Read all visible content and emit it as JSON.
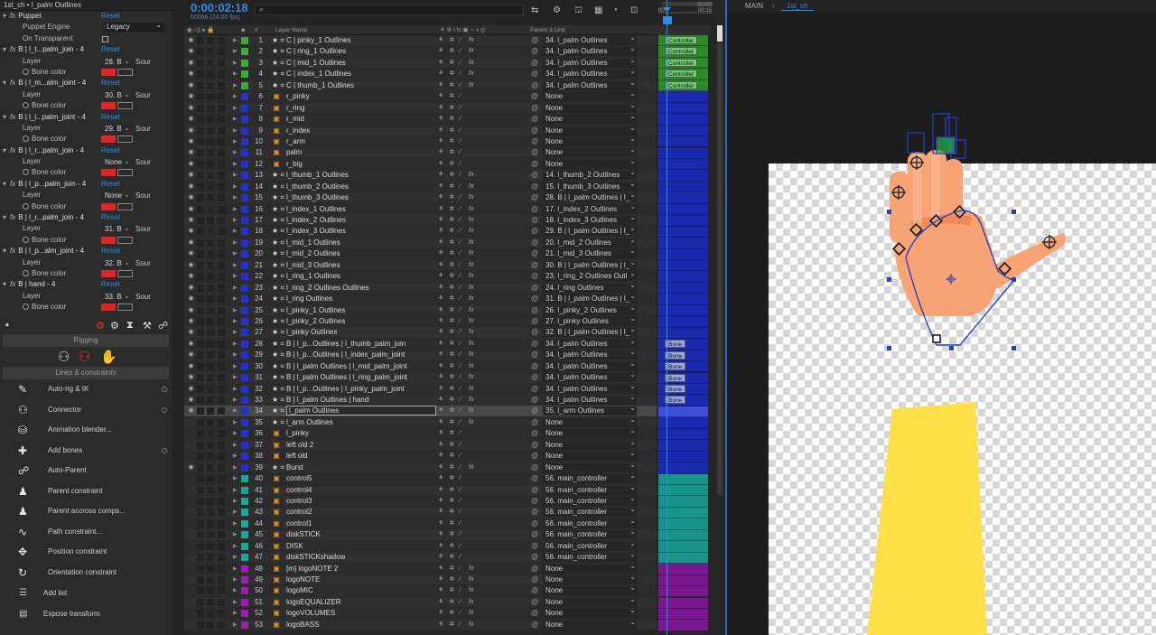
{
  "left": {
    "title": "1st_ch • l_palm Outlines",
    "effects": [
      {
        "kind": "head",
        "label": "Puppet",
        "reset": "Reset"
      },
      {
        "kind": "select",
        "label": "Puppet Engine",
        "value": "Legacy"
      },
      {
        "kind": "check",
        "label": "On Transparent"
      },
      {
        "kind": "head",
        "label": "B | l_t...palm_join - 4",
        "reset": "Reset"
      },
      {
        "kind": "layer",
        "label": "Layer",
        "value": "28. B",
        "dd": "Sour"
      },
      {
        "kind": "color",
        "label": "Bone color"
      },
      {
        "kind": "head",
        "label": "B | l_m...alm_joint - 4",
        "reset": "Reset"
      },
      {
        "kind": "layer",
        "label": "Layer",
        "value": "30. B",
        "dd": "Sour"
      },
      {
        "kind": "color",
        "label": "Bone color"
      },
      {
        "kind": "head",
        "label": "B | l_i...palm_joint - 4",
        "reset": "Reset"
      },
      {
        "kind": "layer",
        "label": "Layer",
        "value": "29. B",
        "dd": "Sour"
      },
      {
        "kind": "color",
        "label": "Bone color"
      },
      {
        "kind": "head",
        "label": "B | l_r...palm_join - 4",
        "reset": "Reset"
      },
      {
        "kind": "layer",
        "label": "Layer",
        "value": "None",
        "dd": "Sour"
      },
      {
        "kind": "color",
        "label": "Bone color"
      },
      {
        "kind": "head",
        "label": "B | l_p...palm_join - 4",
        "reset": "Reset"
      },
      {
        "kind": "layer",
        "label": "Layer",
        "value": "None",
        "dd": "Sour"
      },
      {
        "kind": "color",
        "label": "Bone color"
      },
      {
        "kind": "head",
        "label": "B | l_r...palm_join - 4",
        "reset": "Reset"
      },
      {
        "kind": "layer",
        "label": "Layer",
        "value": "31. B",
        "dd": "Sour"
      },
      {
        "kind": "color",
        "label": "Bone color"
      },
      {
        "kind": "head",
        "label": "B | l_p...alm_joint - 4",
        "reset": "Reset"
      },
      {
        "kind": "layer",
        "label": "Layer",
        "value": "32. B",
        "dd": "Sour"
      },
      {
        "kind": "color",
        "label": "Bone color"
      },
      {
        "kind": "head",
        "label": "B | hand - 4",
        "reset": "Reset"
      },
      {
        "kind": "layer",
        "label": "Layer",
        "value": "33. B",
        "dd": "Sour"
      },
      {
        "kind": "color",
        "label": "Bone color"
      }
    ],
    "bone_color": "#e32424"
  },
  "duik": {
    "rigging_label": "Rigging",
    "links_label": "Links & constraints",
    "items": [
      {
        "label": "Auto-rig & IK",
        "icon": "auto-rig-icon",
        "glyph": "✎",
        "dot": true
      },
      {
        "label": "Connector",
        "icon": "connector-icon",
        "glyph": "⚇",
        "dot": true
      },
      {
        "label": "Animation blender...",
        "icon": "animation-blender-icon",
        "glyph": "⛁",
        "dot": false
      },
      {
        "label": "Add bones",
        "icon": "add-bones-icon",
        "glyph": "✚",
        "dot": true
      },
      {
        "label": "Auto-Parent",
        "icon": "auto-parent-icon",
        "glyph": "☍",
        "dot": false
      },
      {
        "label": "Parent constraint",
        "icon": "parent-constraint-icon",
        "glyph": "♟",
        "dot": false
      },
      {
        "label": "Parent accross comps...",
        "icon": "parent-across-comps-icon",
        "glyph": "♟",
        "dot": false
      },
      {
        "label": "Path constraint...",
        "icon": "path-constraint-icon",
        "glyph": "∿",
        "dot": false
      },
      {
        "label": "Position constraint",
        "icon": "position-constraint-icon",
        "glyph": "✥",
        "dot": false
      },
      {
        "label": "Orientation constraint",
        "icon": "orientation-constraint-icon",
        "glyph": "↻",
        "dot": false
      }
    ],
    "add_list": "Add list",
    "expose_transform": "Expose transform"
  },
  "timeline": {
    "timecode": "0:00:02:18",
    "timecode_sub": "00066 (24.00 fps)",
    "search_placeholder": "⌕",
    "col_layer_name": "Layer Name",
    "col_number": "#",
    "col_parent": "Parent & Link",
    "fx_label": "fx",
    "layers": [
      {
        "n": "1",
        "name": "C | pinky_1 Outlines",
        "type": "shape",
        "color": "#3daa3d",
        "parent": "34. l_palm Outlines",
        "fx": true,
        "eye": true,
        "track": "#2a8a2a",
        "tag": "Controller"
      },
      {
        "n": "2",
        "name": "C | ring_1 Outlines",
        "type": "shape",
        "color": "#3daa3d",
        "parent": "34. l_palm Outlines",
        "fx": true,
        "eye": true,
        "track": "#2a8a2a",
        "tag": "Controller"
      },
      {
        "n": "3",
        "name": "C | mid_1 Outlines",
        "type": "shape",
        "color": "#3daa3d",
        "parent": "34. l_palm Outlines",
        "fx": true,
        "eye": true,
        "track": "#2a8a2a",
        "tag": "Controller"
      },
      {
        "n": "4",
        "name": "C | index_1 Outlines",
        "type": "shape",
        "color": "#3daa3d",
        "parent": "34. l_palm Outlines",
        "fx": true,
        "eye": true,
        "track": "#2a8a2a",
        "tag": "Controller"
      },
      {
        "n": "5",
        "name": "C | thumb_1 Outlines",
        "type": "shape",
        "color": "#3daa3d",
        "parent": "34. l_palm Outlines",
        "fx": true,
        "eye": true,
        "track": "#2a8a2a",
        "tag": "Controller"
      },
      {
        "n": "6",
        "name": "r_pinky",
        "type": "comp",
        "color": "#2233cc",
        "parent": "None",
        "fx": false,
        "eye": true,
        "track": "#1b2bb0",
        "tag": ""
      },
      {
        "n": "7",
        "name": "r_ring",
        "type": "comp",
        "color": "#2233cc",
        "parent": "None",
        "fx": false,
        "eye": true,
        "track": "#1b2bb0",
        "tag": ""
      },
      {
        "n": "8",
        "name": "r_mid",
        "type": "comp",
        "color": "#2233cc",
        "parent": "None",
        "fx": false,
        "eye": true,
        "track": "#1b2bb0",
        "tag": ""
      },
      {
        "n": "9",
        "name": "r_index",
        "type": "comp",
        "color": "#2233cc",
        "parent": "None",
        "fx": false,
        "eye": true,
        "track": "#1b2bb0",
        "tag": ""
      },
      {
        "n": "10",
        "name": "r_arm",
        "type": "comp",
        "color": "#2233cc",
        "parent": "None",
        "fx": false,
        "eye": true,
        "track": "#1b2bb0",
        "tag": ""
      },
      {
        "n": "11",
        "name": "palm",
        "type": "comp",
        "color": "#2233cc",
        "parent": "None",
        "fx": false,
        "eye": true,
        "track": "#1b2bb0",
        "tag": ""
      },
      {
        "n": "12",
        "name": "r_big",
        "type": "comp",
        "color": "#2233cc",
        "parent": "None",
        "fx": false,
        "eye": true,
        "track": "#1b2bb0",
        "tag": ""
      },
      {
        "n": "13",
        "name": "l_thumb_1 Outlines",
        "type": "shape",
        "color": "#2233cc",
        "parent": "14. l_thumb_2 Outlines",
        "fx": true,
        "eye": true,
        "track": "#1b2bb0",
        "tag": ""
      },
      {
        "n": "14",
        "name": "l_thumb_2 Outlines",
        "type": "shape",
        "color": "#2233cc",
        "parent": "15. l_thumb_3 Outlines",
        "fx": true,
        "eye": true,
        "track": "#1b2bb0",
        "tag": ""
      },
      {
        "n": "15",
        "name": "l_thumb_3 Outlines",
        "type": "shape",
        "color": "#2233cc",
        "parent": "28. B | l_palm Outlines | l_",
        "fx": true,
        "eye": true,
        "track": "#1b2bb0",
        "tag": ""
      },
      {
        "n": "16",
        "name": "l_index_1 Outlines",
        "type": "shape",
        "color": "#2233cc",
        "parent": "17. l_index_2 Outlines",
        "fx": true,
        "eye": true,
        "track": "#1b2bb0",
        "tag": ""
      },
      {
        "n": "17",
        "name": "l_index_2 Outlines",
        "type": "shape",
        "color": "#2233cc",
        "parent": "18. l_index_3 Outlines",
        "fx": true,
        "eye": true,
        "track": "#1b2bb0",
        "tag": ""
      },
      {
        "n": "18",
        "name": "l_index_3 Outlines",
        "type": "shape",
        "color": "#2233cc",
        "parent": "29. B | l_palm Outlines | l_",
        "fx": true,
        "eye": true,
        "track": "#1b2bb0",
        "tag": ""
      },
      {
        "n": "19",
        "name": "l_mid_1 Outlines",
        "type": "shape",
        "color": "#2233cc",
        "parent": "20. l_mid_2 Outlines",
        "fx": true,
        "eye": true,
        "track": "#1b2bb0",
        "tag": ""
      },
      {
        "n": "20",
        "name": "l_mid_2 Outlines",
        "type": "shape",
        "color": "#2233cc",
        "parent": "21. l_mid_3 Outlines",
        "fx": true,
        "eye": true,
        "track": "#1b2bb0",
        "tag": ""
      },
      {
        "n": "21",
        "name": "l_mid_3 Outlines",
        "type": "shape",
        "color": "#2233cc",
        "parent": "30. B | l_palm Outlines | l_",
        "fx": true,
        "eye": true,
        "track": "#1b2bb0",
        "tag": ""
      },
      {
        "n": "22",
        "name": "l_ring_1 Outlines",
        "type": "shape",
        "color": "#2233cc",
        "parent": "23. l_ring_2 Outlines Outl",
        "fx": true,
        "eye": true,
        "track": "#1b2bb0",
        "tag": ""
      },
      {
        "n": "23",
        "name": "l_ring_2 Outlines Outlines",
        "type": "shape",
        "color": "#2233cc",
        "parent": "24. l_ring Outlines",
        "fx": true,
        "eye": true,
        "track": "#1b2bb0",
        "tag": ""
      },
      {
        "n": "24",
        "name": "l_ring Outlines",
        "type": "shape",
        "color": "#2233cc",
        "parent": "31. B | l_palm Outlines | l_",
        "fx": true,
        "eye": true,
        "track": "#1b2bb0",
        "tag": ""
      },
      {
        "n": "25",
        "name": "l_pinky_1 Outlines",
        "type": "shape",
        "color": "#2233cc",
        "parent": "26. l_pinky_2 Outlines",
        "fx": true,
        "eye": true,
        "track": "#1b2bb0",
        "tag": ""
      },
      {
        "n": "26",
        "name": "l_pinky_2 Outlines",
        "type": "shape",
        "color": "#2233cc",
        "parent": "27. l_pinky Outlines",
        "fx": true,
        "eye": true,
        "track": "#1b2bb0",
        "tag": ""
      },
      {
        "n": "27",
        "name": "l_pinky Outlines",
        "type": "shape",
        "color": "#2233cc",
        "parent": "32. B | l_palm Outlines | l_",
        "fx": true,
        "eye": true,
        "track": "#1b2bb0",
        "tag": ""
      },
      {
        "n": "28",
        "name": "B | l_p...Outlines | l_thumb_palm_join",
        "type": "shape",
        "color": "#2233cc",
        "parent": "34. l_palm Outlines",
        "fx": true,
        "eye": true,
        "track": "#1b2bb0",
        "tag": "Bone"
      },
      {
        "n": "29",
        "name": "B | l_p...Outlines | l_index_palm_joint",
        "type": "shape",
        "color": "#2233cc",
        "parent": "34. l_palm Outlines",
        "fx": true,
        "eye": true,
        "track": "#1b2bb0",
        "tag": "Bone"
      },
      {
        "n": "30",
        "name": "B | l_palm Outlines | l_mid_palm_joint",
        "type": "shape",
        "color": "#2233cc",
        "parent": "34. l_palm Outlines",
        "fx": true,
        "eye": true,
        "track": "#1b2bb0",
        "tag": "Bone"
      },
      {
        "n": "31",
        "name": "B | l_palm Outlines | l_ring_palm_joint",
        "type": "shape",
        "color": "#2233cc",
        "parent": "34. l_palm Outlines",
        "fx": true,
        "eye": true,
        "track": "#1b2bb0",
        "tag": "Bone"
      },
      {
        "n": "32",
        "name": "B | l_p...Outlines | l_pinky_palm_joint",
        "type": "shape",
        "color": "#2233cc",
        "parent": "34. l_palm Outlines",
        "fx": true,
        "eye": true,
        "track": "#1b2bb0",
        "tag": "Bone"
      },
      {
        "n": "33",
        "name": "B | l_palm Outlines | hand",
        "type": "shape",
        "color": "#2233cc",
        "parent": "34. l_palm Outlines",
        "fx": true,
        "eye": true,
        "track": "#1b2bb0",
        "tag": "Bone"
      },
      {
        "n": "34",
        "name": "l_palm Outlines",
        "type": "shape",
        "color": "#2233cc",
        "parent": "35. l_arm Outlines",
        "fx": true,
        "eye": true,
        "track": "#3d4fd8",
        "tag": "",
        "selected": true
      },
      {
        "n": "35",
        "name": "l_arm Outlines",
        "type": "shape",
        "color": "#2233cc",
        "parent": "None",
        "fx": true,
        "eye": false,
        "track": "#1b2bb0",
        "tag": ""
      },
      {
        "n": "36",
        "name": "l_pinky",
        "type": "comp",
        "color": "#2233cc",
        "parent": "None",
        "fx": false,
        "eye": false,
        "track": "#1b2bb0",
        "tag": ""
      },
      {
        "n": "37",
        "name": "left old 2",
        "type": "comp",
        "color": "#2233cc",
        "parent": "None",
        "fx": false,
        "eye": false,
        "track": "#1b2bb0",
        "tag": ""
      },
      {
        "n": "38",
        "name": "left old",
        "type": "comp",
        "color": "#2233cc",
        "parent": "None",
        "fx": false,
        "eye": false,
        "track": "#1b2bb0",
        "tag": ""
      },
      {
        "n": "39",
        "name": "Burst",
        "type": "shape",
        "color": "#2233cc",
        "parent": "None",
        "fx": true,
        "eye": true,
        "track": "#1b2bb0",
        "tag": ""
      },
      {
        "n": "40",
        "name": "control5",
        "type": "comp",
        "color": "#1ca59a",
        "parent": "56. main_controller",
        "fx": false,
        "eye": false,
        "track": "#17958b",
        "tag": ""
      },
      {
        "n": "41",
        "name": "control4",
        "type": "comp",
        "color": "#1ca59a",
        "parent": "56. main_controller",
        "fx": false,
        "eye": false,
        "track": "#17958b",
        "tag": ""
      },
      {
        "n": "42",
        "name": "control3",
        "type": "comp",
        "color": "#1ca59a",
        "parent": "56. main_controller",
        "fx": false,
        "eye": false,
        "track": "#17958b",
        "tag": ""
      },
      {
        "n": "43",
        "name": "control2",
        "type": "comp",
        "color": "#1ca59a",
        "parent": "56. main_controller",
        "fx": false,
        "eye": false,
        "track": "#17958b",
        "tag": ""
      },
      {
        "n": "44",
        "name": "control1",
        "type": "comp",
        "color": "#1ca59a",
        "parent": "56. main_controller",
        "fx": false,
        "eye": false,
        "track": "#17958b",
        "tag": ""
      },
      {
        "n": "45",
        "name": "diskSTICK",
        "type": "comp",
        "color": "#1ca59a",
        "parent": "56. main_controller",
        "fx": false,
        "eye": false,
        "track": "#17958b",
        "tag": ""
      },
      {
        "n": "46",
        "name": "DISK",
        "type": "comp",
        "color": "#1ca59a",
        "parent": "56. main_controller",
        "fx": false,
        "eye": false,
        "track": "#17958b",
        "tag": ""
      },
      {
        "n": "47",
        "name": "diskSTICKshadow",
        "type": "comp",
        "color": "#1ca59a",
        "parent": "56. main_controller",
        "fx": false,
        "eye": false,
        "track": "#17958b",
        "tag": ""
      },
      {
        "n": "48",
        "name": "[m] logoNOTE 2",
        "type": "comp",
        "color": "#9a1fb0",
        "parent": "None",
        "fx": true,
        "eye": false,
        "track": "#7a1890",
        "tag": ""
      },
      {
        "n": "49",
        "name": "logoNOTE",
        "type": "comp",
        "color": "#9a1fb0",
        "parent": "None",
        "fx": true,
        "eye": false,
        "track": "#7a1890",
        "tag": ""
      },
      {
        "n": "50",
        "name": "logoMIC",
        "type": "comp",
        "color": "#9a1fb0",
        "parent": "None",
        "fx": true,
        "eye": false,
        "track": "#7a1890",
        "tag": ""
      },
      {
        "n": "51",
        "name": "logoEQUALIZER",
        "type": "comp",
        "color": "#9a1fb0",
        "parent": "None",
        "fx": true,
        "eye": false,
        "track": "#7a1890",
        "tag": ""
      },
      {
        "n": "52",
        "name": "logoVOLUMES",
        "type": "comp",
        "color": "#9a1fb0",
        "parent": "None",
        "fx": true,
        "eye": false,
        "track": "#7a1890",
        "tag": ""
      },
      {
        "n": "53",
        "name": "logoBASS",
        "type": "comp",
        "color": "#9a1fb0",
        "parent": "None",
        "fx": true,
        "eye": false,
        "track": "#7a1890",
        "tag": ""
      }
    ]
  },
  "track": {
    "ruler_start": "00f",
    "ruler_end": "00:15"
  },
  "comp": {
    "tab_main": "MAIN",
    "tab_active": "1st_ch",
    "accent": "#2d8ceb",
    "skin_color": "#f7a374",
    "yellow": "#ffe047"
  }
}
